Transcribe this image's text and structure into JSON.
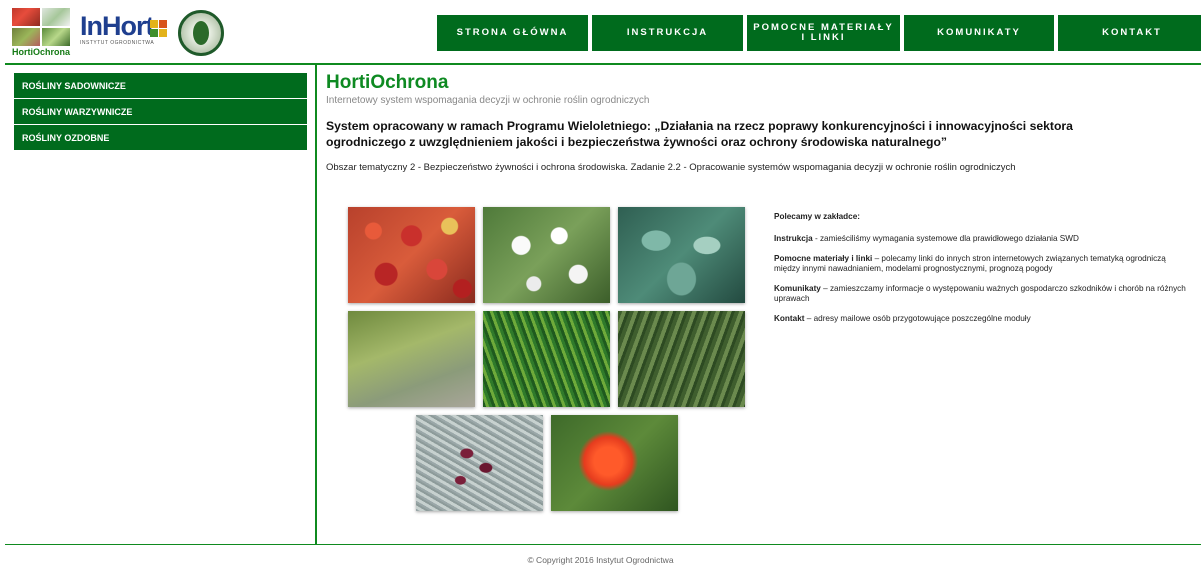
{
  "header": {
    "logo_caption": "HortiOchrona",
    "inhort_logo": "InHort",
    "inhort_sub": "INSTYTUT OGRODNICTWA",
    "emblem_icon": "wheat-emblem-icon"
  },
  "nav": {
    "items": [
      {
        "label": "STRONA GŁÓWNA"
      },
      {
        "label": "INSTRUKCJA"
      },
      {
        "label": "POMOCNE MATERIAŁY I LINKI"
      },
      {
        "label": "KOMUNIKATY"
      },
      {
        "label": "KONTAKT"
      }
    ]
  },
  "sidebar": {
    "items": [
      {
        "label": "ROŚLINY SADOWNICZE"
      },
      {
        "label": "ROŚLINY WARZYWNICZE"
      },
      {
        "label": "ROŚLINY OZDOBNE"
      }
    ]
  },
  "main": {
    "title": "HortiOchrona",
    "subtitle": "Internetowy system wspomagania decyzji w ochronie roślin ogrodniczych",
    "program": "System opracowany w ramach Programu Wieloletniego: „Działania na rzecz poprawy konkurencyjności i innowacyjności sektora ogrodniczego z uwzględnieniem jakości i bezpieczeństwa żywności oraz ochrony środowiska naturalnego”",
    "area": "Obszar tematyczny 2 - Bezpieczeństwo żywności i ochrona środowiska. Zadanie 2.2 - Opracowanie systemów wspomagania decyzji w ochronie roślin ogrodniczych"
  },
  "recommend": {
    "heading": "Polecamy w zakładce:",
    "items": [
      {
        "term": "Instrukcja",
        "text": " - zamieściliśmy wymagania systemowe dla prawidłowego działania SWD"
      },
      {
        "term": "Pomocne materiały i linki",
        "text": " – polecamy linki do innych stron internetowych związanych tematyką ogrodniczą między innymi nawadnianiem, modelami prognostycznymi, prognozą pogody"
      },
      {
        "term": "Komunikaty",
        "text": " – zamieszczamy informacje o występowaniu ważnych gospodarczo szkodników i chorób na różnych uprawach"
      },
      {
        "term": "Kontakt",
        "text": " – adresy mailowe osób przygotowujące poszczególne moduły"
      }
    ]
  },
  "colors": {
    "brand_green": "#006b1d",
    "title_green": "#0e8a22"
  },
  "footer": {
    "copyright": "© Copyright 2016 Instytut Ogrodnictwa"
  }
}
